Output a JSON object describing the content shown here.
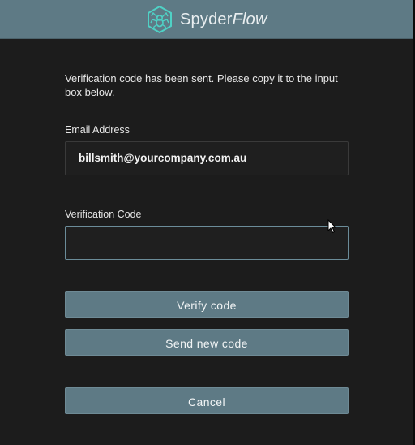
{
  "header": {
    "brand_main": "Spyder",
    "brand_accent": "Flow",
    "logo_icon": "spider-icon",
    "background": "#5e7a85"
  },
  "message": "Verification code has been sent. Please copy it to the input box below.",
  "email": {
    "label": "Email Address",
    "value": "billsmith@yourcompany.com.au"
  },
  "verification": {
    "label": "Verification Code",
    "value": "",
    "placeholder": ""
  },
  "buttons": {
    "verify_label": "Verify code",
    "resend_label": "Send new code",
    "cancel_label": "Cancel"
  },
  "colors": {
    "accent": "#5e7a85",
    "background": "#1c1c1c",
    "focus_border": "#6b8c99"
  }
}
